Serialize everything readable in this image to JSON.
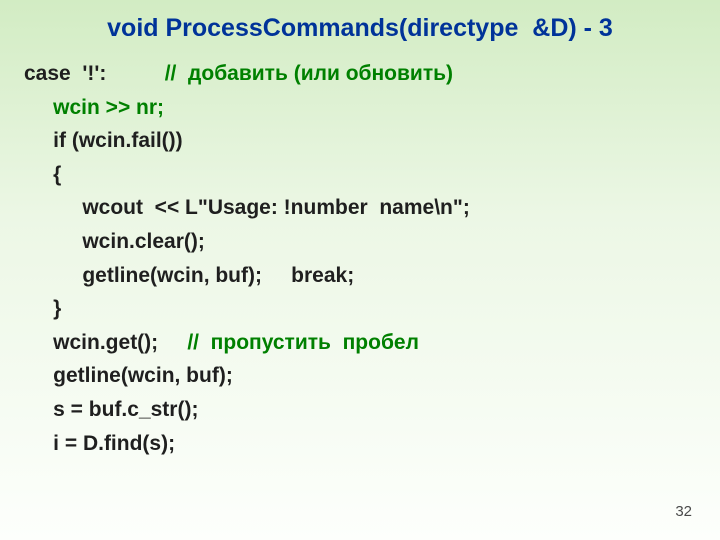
{
  "title": "void ProcessCommands(directype  &D) - 3",
  "lines": {
    "l0a": "case  '!':          ",
    "l0b": "//  добавить (или обновить)",
    "l1": "     wcin >> nr;",
    "l2": "     if (wcin.fail())",
    "l3": "     {",
    "l4": "          wcout  << L\"Usage: !number  name\\n\";",
    "l5": "          wcin.clear();",
    "l6": "          getline(wcin, buf);     break;",
    "l7": "     }",
    "l8a": "     wcin.get();     ",
    "l8b": "//  пропустить  пробел",
    "l9": "     getline(wcin, buf);",
    "l10": "     s = buf.c_str();",
    "l11": "     i = D.find(s);"
  },
  "page": "32"
}
